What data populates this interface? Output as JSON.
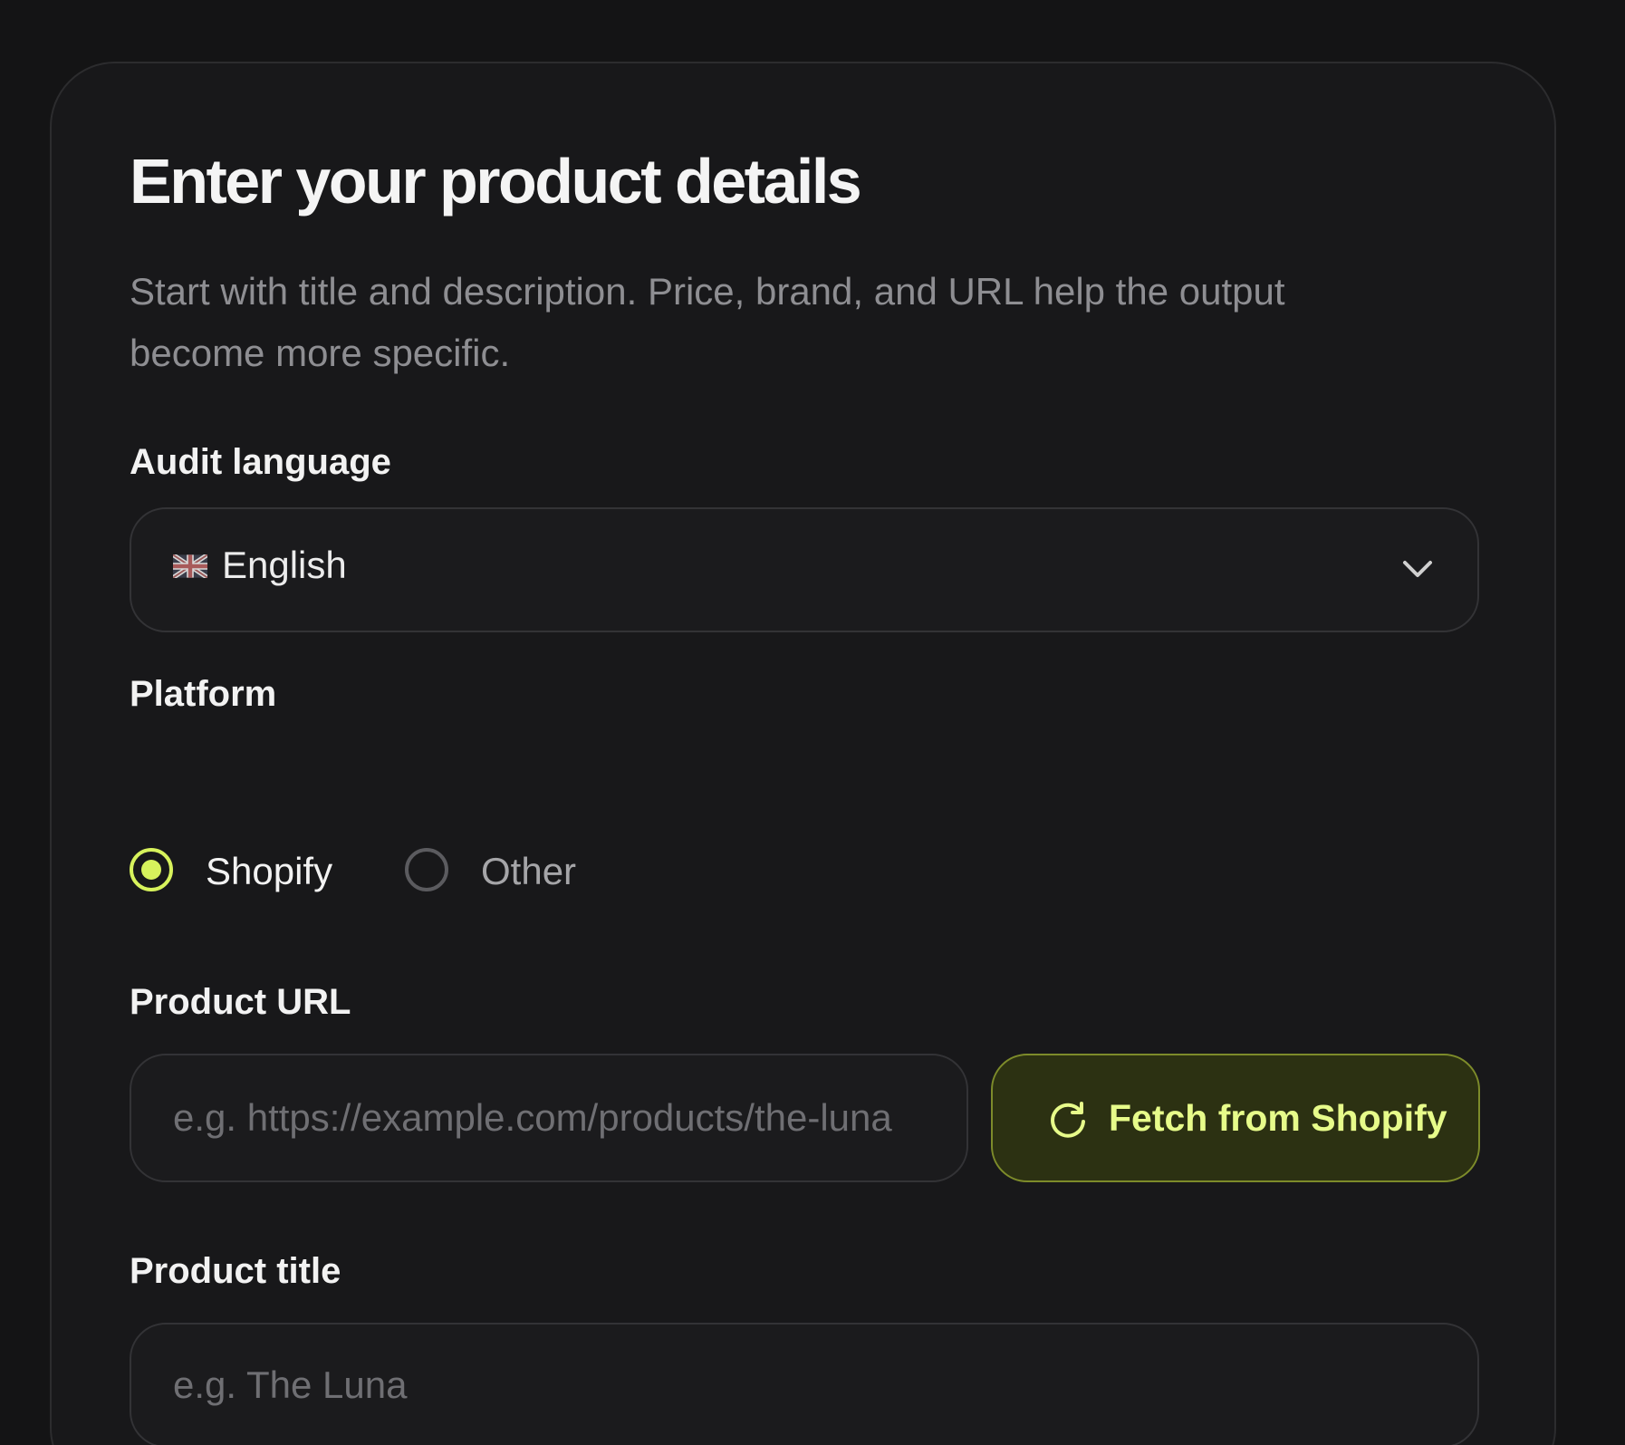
{
  "form": {
    "title": "Enter your product details",
    "subtitle": "Start with title and description. Price, brand, and URL help the output become more specific."
  },
  "audit_language": {
    "label": "Audit language",
    "selected_value": "English",
    "flag_icon": "uk-flag-icon"
  },
  "platform": {
    "label": "Platform",
    "options": [
      {
        "label": "Shopify",
        "checked": true
      },
      {
        "label": "Other",
        "checked": false
      }
    ]
  },
  "product_url": {
    "label": "Product URL",
    "placeholder": "e.g. https://example.com/products/the-luna",
    "value": ""
  },
  "fetch_button": {
    "label": "Fetch from Shopify",
    "icon": "refresh-icon"
  },
  "product_title": {
    "label": "Product title",
    "placeholder": "e.g. The Luna",
    "value": ""
  },
  "colors": {
    "accent": "#d7f25c",
    "background": "#141415",
    "card": "#18181a"
  }
}
